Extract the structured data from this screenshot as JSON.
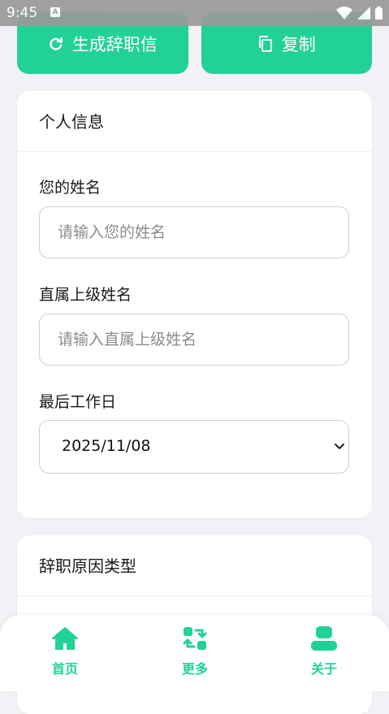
{
  "status_bar": {
    "time": "9:45",
    "indicator": "A"
  },
  "actions": [
    {
      "label": "生成辞职信",
      "icon": "refresh-icon"
    },
    {
      "label": "复制",
      "icon": "copy-icon"
    }
  ],
  "personal_card": {
    "title": "个人信息",
    "name_label": "您的姓名",
    "name_placeholder": "请输入您的姓名",
    "supervisor_label": "直属上级姓名",
    "supervisor_placeholder": "请输入直属上级姓名",
    "last_day_label": "最后工作日",
    "last_day_value": "2025/11/08"
  },
  "reason_card": {
    "title": "辞职原因类型"
  },
  "bottom_nav": [
    {
      "label": "首页",
      "icon": "home-icon"
    },
    {
      "label": "更多",
      "icon": "swap-icon"
    },
    {
      "label": "关于",
      "icon": "user-icon"
    }
  ],
  "colors": {
    "accent": "#22d195",
    "background": "#f2f2f6",
    "card": "#ffffff"
  }
}
